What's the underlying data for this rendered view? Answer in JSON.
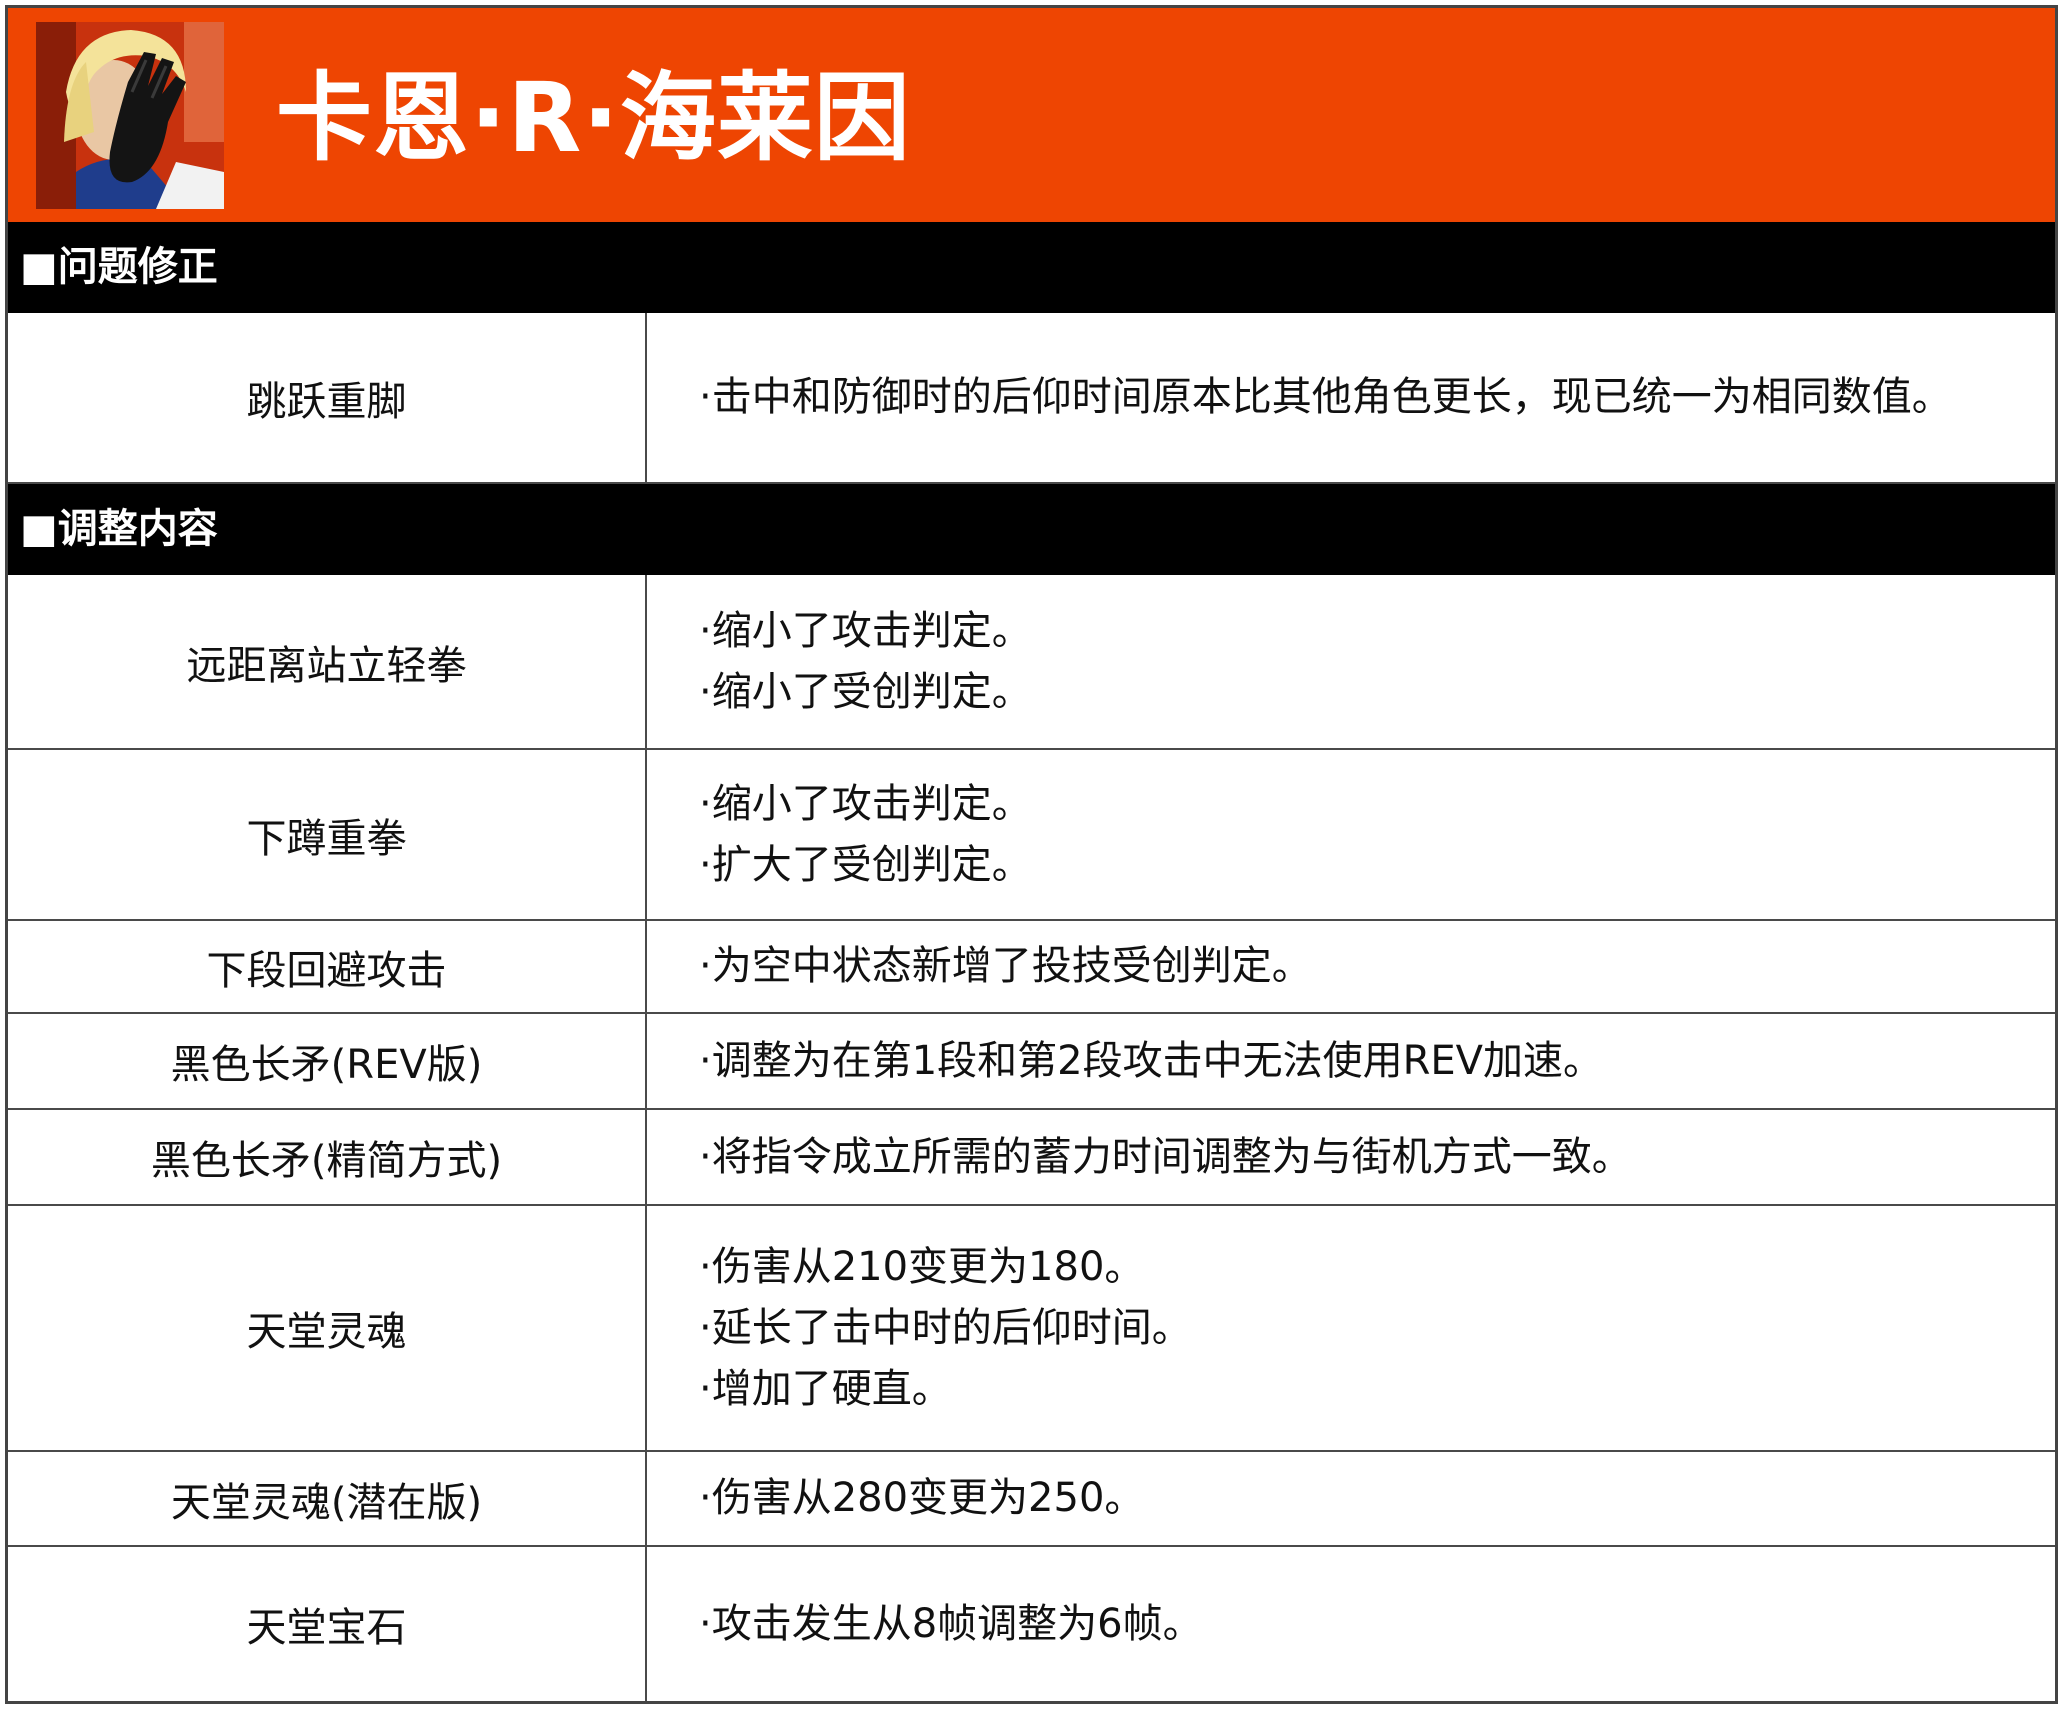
{
  "header": {
    "character_name": "卡恩·R·海莱因",
    "colors": {
      "banner": "#ee4502",
      "section_bar": "#000000",
      "text": "#111111"
    },
    "portrait_icon": "character-portrait"
  },
  "sections": [
    {
      "title": "■问题修正",
      "rows": [
        {
          "move": "跳跃重脚",
          "changes": [
            "·击中和防御时的后仰时间原本比其他角色更长，现已统一为相同数值。"
          ]
        }
      ]
    },
    {
      "title": "■调整内容",
      "rows": [
        {
          "move": "远距离站立轻拳",
          "changes": [
            "·缩小了攻击判定。",
            "·缩小了受创判定。"
          ]
        },
        {
          "move": "下蹲重拳",
          "changes": [
            "·缩小了攻击判定。",
            "·扩大了受创判定。"
          ]
        },
        {
          "move": "下段回避攻击",
          "changes": [
            "·为空中状态新增了投技受创判定。"
          ]
        },
        {
          "move": "黑色长矛(REV版)",
          "changes": [
            "·调整为在第1段和第2段攻击中无法使用REV加速。"
          ]
        },
        {
          "move": "黑色长矛(精简方式)",
          "changes": [
            "·将指令成立所需的蓄力时间调整为与街机方式一致。"
          ]
        },
        {
          "move": "天堂灵魂",
          "changes": [
            "·伤害从210变更为180。",
            "·延长了击中时的后仰时间。",
            "·增加了硬直。"
          ]
        },
        {
          "move": "天堂灵魂(潜在版)",
          "changes": [
            "·伤害从280变更为250。"
          ]
        },
        {
          "move": "天堂宝石",
          "changes": [
            "·攻击发生从8帧调整为6帧。"
          ]
        }
      ]
    }
  ]
}
